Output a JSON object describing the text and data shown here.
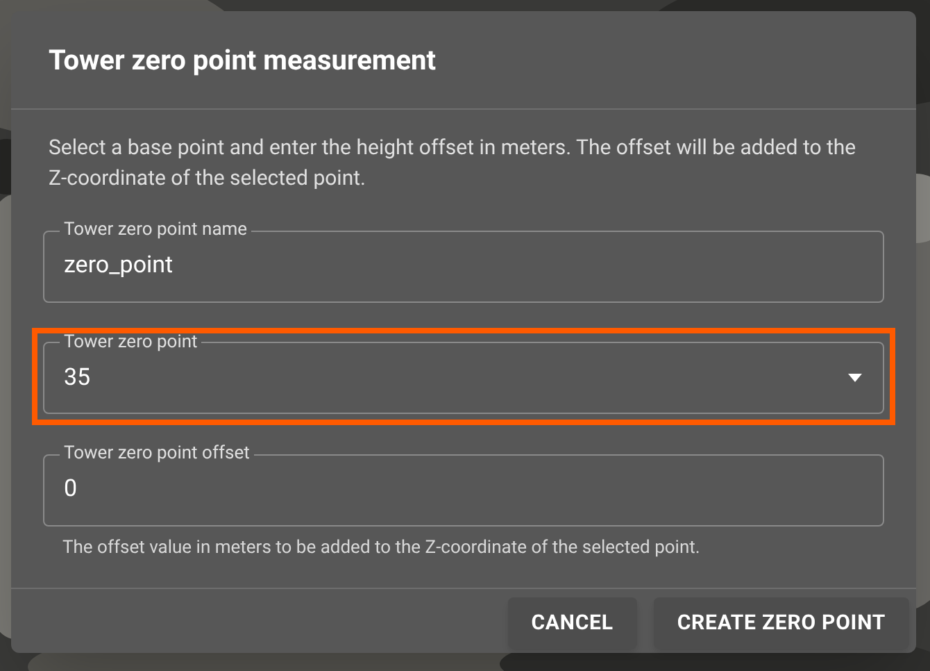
{
  "dialog": {
    "title": "Tower zero point measurement",
    "description": "Select a base point and enter the height offset in meters. The offset will be added to the Z-coordinate of the selected point.",
    "fields": [
      {
        "kind": "text",
        "label": "Tower zero point name",
        "value": "zero_point",
        "highlighted": false
      },
      {
        "kind": "select",
        "label": "Tower zero point",
        "value": "35",
        "highlighted": true
      },
      {
        "kind": "text",
        "label": "Tower zero point offset",
        "value": "0",
        "helper": "The offset value in meters to be added to the Z-coordinate of the selected point.",
        "highlighted": false
      }
    ],
    "buttons": [
      "CANCEL",
      "CREATE ZERO POINT"
    ]
  }
}
